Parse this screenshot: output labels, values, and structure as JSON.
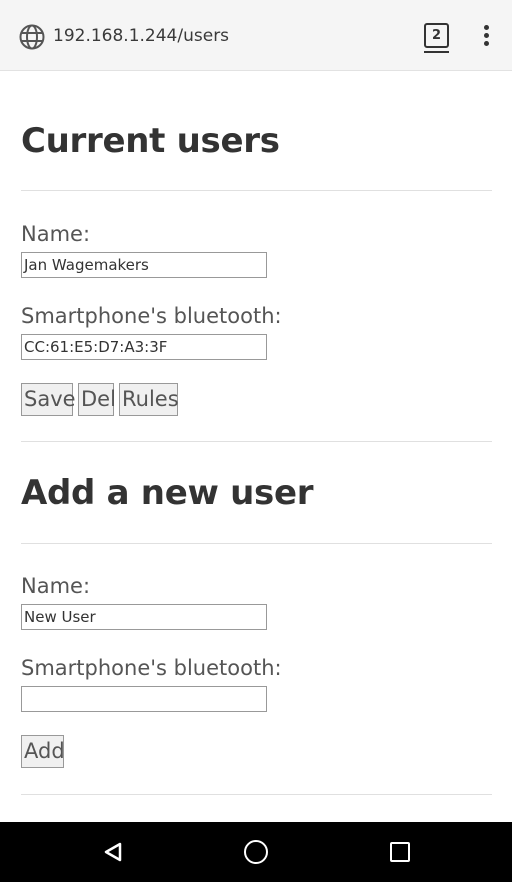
{
  "browser": {
    "url": "192.168.1.244/users",
    "tab_count": "2"
  },
  "current_users": {
    "title": "Current users",
    "name_label": "Name:",
    "name_value": "Jan Wagemakers",
    "bt_label": "Smartphone's bluetooth:",
    "bt_value": "CC:61:E5:D7:A3:3F",
    "save_label": "Save",
    "del_label": "Del",
    "rules_label": "Rules"
  },
  "add_user": {
    "title": "Add a new user",
    "name_label": "Name:",
    "name_value": "New User",
    "bt_label": "Smartphone's bluetooth:",
    "bt_value": "",
    "add_label": "Add"
  },
  "icons": {
    "globe": "globe-icon",
    "tabs": "tab-switcher-icon",
    "menu": "overflow-menu-icon",
    "back": "nav-back-icon",
    "home": "nav-home-icon",
    "recent": "nav-recents-icon"
  }
}
